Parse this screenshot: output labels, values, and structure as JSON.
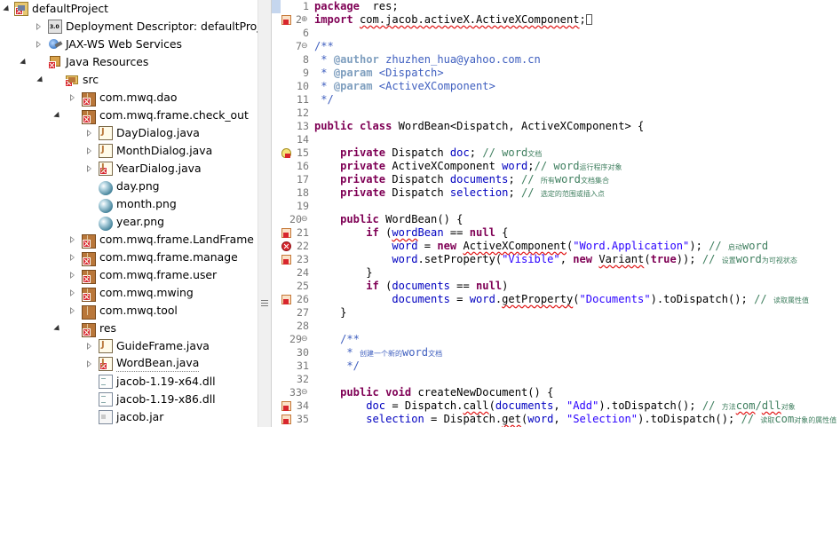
{
  "explorer": {
    "items": [
      {
        "label": "defaultProject",
        "icon": "project-icon",
        "arrow": "expanded",
        "err": true
      },
      {
        "label": "Deployment Descriptor: defaultProject",
        "icon": "deployment-descriptor-icon",
        "arrow": "collapsed",
        "err": false
      },
      {
        "label": "JAX-WS Web Services",
        "icon": "jax-ws-icon",
        "arrow": "collapsed",
        "err": false
      },
      {
        "label": "Java Resources",
        "icon": "java-resources-icon",
        "arrow": "expanded",
        "err": true
      },
      {
        "label": "src",
        "icon": "source-folder-icon",
        "arrow": "expanded",
        "err": true
      },
      {
        "label": "com.mwq.dao",
        "icon": "package-icon",
        "arrow": "collapsed",
        "err": true
      },
      {
        "label": "com.mwq.frame.check_out",
        "icon": "package-icon",
        "arrow": "expanded",
        "err": true
      },
      {
        "label": "DayDialog.java",
        "icon": "java-file-icon",
        "arrow": "collapsed",
        "err": false
      },
      {
        "label": "MonthDialog.java",
        "icon": "java-file-icon",
        "arrow": "collapsed",
        "err": false
      },
      {
        "label": "YearDialog.java",
        "icon": "java-file-icon",
        "arrow": "collapsed",
        "err": true
      },
      {
        "label": "day.png",
        "icon": "png-file-icon",
        "arrow": "none",
        "err": false
      },
      {
        "label": "month.png",
        "icon": "png-file-icon",
        "arrow": "none",
        "err": false
      },
      {
        "label": "year.png",
        "icon": "png-file-icon",
        "arrow": "none",
        "err": false
      },
      {
        "label": "com.mwq.frame.LandFrame",
        "icon": "package-icon",
        "arrow": "collapsed",
        "err": true
      },
      {
        "label": "com.mwq.frame.manage",
        "icon": "package-icon",
        "arrow": "collapsed",
        "err": true
      },
      {
        "label": "com.mwq.frame.user",
        "icon": "package-icon",
        "arrow": "collapsed",
        "err": true
      },
      {
        "label": "com.mwq.mwing",
        "icon": "package-icon",
        "arrow": "collapsed",
        "err": true
      },
      {
        "label": "com.mwq.tool",
        "icon": "package-icon",
        "arrow": "collapsed",
        "err": false
      },
      {
        "label": "res",
        "icon": "package-icon",
        "arrow": "expanded",
        "err": true
      },
      {
        "label": "GuideFrame.java",
        "icon": "java-file-icon",
        "arrow": "collapsed",
        "err": false
      },
      {
        "label": "WordBean.java",
        "icon": "java-file-icon",
        "arrow": "collapsed",
        "err": true,
        "selected": true
      },
      {
        "label": "jacob-1.19-x64.dll",
        "icon": "dll-file-icon",
        "arrow": "none",
        "err": false
      },
      {
        "label": "jacob-1.19-x86.dll",
        "icon": "dll-file-icon",
        "arrow": "none",
        "err": false
      },
      {
        "label": "jacob.jar",
        "icon": "jar-file-icon",
        "arrow": "none",
        "err": false
      }
    ]
  },
  "editor": {
    "lines": [
      {
        "n": "1",
        "gutter": "",
        "fold": "",
        "code": [
          [
            "kw",
            "package"
          ],
          [
            "",
            "  res;"
          ]
        ]
      },
      {
        "n": "2",
        "gutter": "err",
        "fold": "⊕",
        "code": [
          [
            "kw",
            "import"
          ],
          [
            "",
            " "
          ],
          [
            "squig",
            "com.jacob.activeX.ActiveXComponent"
          ],
          [
            "",
            ";"
          ],
          [
            "caret",
            ""
          ]
        ]
      },
      {
        "n": "6",
        "gutter": "",
        "fold": "",
        "code": []
      },
      {
        "n": "7",
        "gutter": "",
        "fold": "⊖",
        "code": [
          [
            "jd",
            "/**"
          ]
        ]
      },
      {
        "n": "8",
        "gutter": "",
        "fold": "",
        "code": [
          [
            "jd",
            " * "
          ],
          [
            "tag",
            "@author"
          ],
          [
            "jd",
            " zhuzhen_hua@yahoo.com.cn"
          ]
        ]
      },
      {
        "n": "9",
        "gutter": "",
        "fold": "",
        "code": [
          [
            "jd",
            " * "
          ],
          [
            "tag",
            "@param"
          ],
          [
            "jd",
            " <Dispatch>"
          ]
        ]
      },
      {
        "n": "10",
        "gutter": "",
        "fold": "",
        "code": [
          [
            "jd",
            " * "
          ],
          [
            "tag",
            "@param"
          ],
          [
            "jd",
            " <ActiveXComponent>"
          ]
        ]
      },
      {
        "n": "11",
        "gutter": "",
        "fold": "",
        "code": [
          [
            "jd",
            " */"
          ]
        ]
      },
      {
        "n": "12",
        "gutter": "",
        "fold": "",
        "code": []
      },
      {
        "n": "13",
        "gutter": "",
        "fold": "",
        "code": [
          [
            "kw",
            "public class"
          ],
          [
            "",
            " WordBean<Dispatch, ActiveXComponent> {"
          ]
        ]
      },
      {
        "n": "14",
        "gutter": "",
        "fold": "",
        "code": []
      },
      {
        "n": "15",
        "gutter": "bulb",
        "fold": "",
        "code": [
          [
            "",
            "    "
          ],
          [
            "kw",
            "private"
          ],
          [
            "",
            " Dispatch "
          ],
          [
            "fld",
            "doc"
          ],
          [
            "",
            "; "
          ],
          [
            "cmt",
            "// word"
          ],
          [
            "cmt cjk",
            "文档"
          ]
        ]
      },
      {
        "n": "16",
        "gutter": "",
        "fold": "",
        "code": [
          [
            "",
            "    "
          ],
          [
            "kw",
            "private"
          ],
          [
            "",
            " ActiveXComponent "
          ],
          [
            "fld",
            "word"
          ],
          [
            "",
            ";"
          ],
          [
            "cmt",
            "// word"
          ],
          [
            "cmt cjk",
            "运行程序对象"
          ]
        ]
      },
      {
        "n": "17",
        "gutter": "",
        "fold": "",
        "code": [
          [
            "",
            "    "
          ],
          [
            "kw",
            "private"
          ],
          [
            "",
            " Dispatch "
          ],
          [
            "fld",
            "documents"
          ],
          [
            "",
            "; "
          ],
          [
            "cmt",
            "// "
          ],
          [
            "cmt cjk",
            "所有"
          ],
          [
            "cmt",
            "word"
          ],
          [
            "cmt cjk",
            "文档集合"
          ]
        ]
      },
      {
        "n": "18",
        "gutter": "",
        "fold": "",
        "code": [
          [
            "",
            "    "
          ],
          [
            "kw",
            "private"
          ],
          [
            "",
            " Dispatch "
          ],
          [
            "fld",
            "selection"
          ],
          [
            "",
            "; "
          ],
          [
            "cmt",
            "// "
          ],
          [
            "cmt cjk",
            "选定的范围或插入点"
          ]
        ]
      },
      {
        "n": "19",
        "gutter": "",
        "fold": "",
        "code": []
      },
      {
        "n": "20",
        "gutter": "",
        "fold": "⊖",
        "code": [
          [
            "",
            "    "
          ],
          [
            "kw",
            "public"
          ],
          [
            "",
            " WordBean() {"
          ]
        ]
      },
      {
        "n": "21",
        "gutter": "err",
        "fold": "",
        "code": [
          [
            "",
            "        "
          ],
          [
            "kw",
            "if"
          ],
          [
            "",
            " ("
          ],
          [
            "fld squig",
            "word"
          ],
          [
            "fld",
            "Bean"
          ],
          [
            "",
            " == "
          ],
          [
            "kw",
            "null"
          ],
          [
            "",
            " {"
          ]
        ]
      },
      {
        "n": "22",
        "gutter": "circle",
        "fold": "",
        "code": [
          [
            "",
            "            "
          ],
          [
            "fld",
            "word"
          ],
          [
            "",
            " = "
          ],
          [
            "kw",
            "new"
          ],
          [
            "",
            " "
          ],
          [
            "squig",
            "ActiveXComponent"
          ],
          [
            "",
            "("
          ],
          [
            "str",
            "\"Word.Application\""
          ],
          [
            "",
            "); "
          ],
          [
            "cmt",
            "// "
          ],
          [
            "cmt cjk",
            "启动"
          ],
          [
            "cmt",
            "word"
          ]
        ]
      },
      {
        "n": "23",
        "gutter": "err",
        "fold": "",
        "code": [
          [
            "",
            "            "
          ],
          [
            "fld",
            "word"
          ],
          [
            "",
            ".setProperty("
          ],
          [
            "str",
            "\"Visible\""
          ],
          [
            "",
            ", "
          ],
          [
            "kw",
            "new"
          ],
          [
            "",
            " "
          ],
          [
            "squig",
            "Variant"
          ],
          [
            "",
            "("
          ],
          [
            "kw",
            "true"
          ],
          [
            "",
            "));"
          ],
          [
            "",
            " "
          ],
          [
            "cmt",
            "// "
          ],
          [
            "cmt cjk",
            "设置"
          ],
          [
            "cmt",
            "word"
          ],
          [
            "cmt cjk",
            "为可视状态"
          ]
        ]
      },
      {
        "n": "24",
        "gutter": "",
        "fold": "",
        "code": [
          [
            "",
            "        }"
          ]
        ]
      },
      {
        "n": "25",
        "gutter": "",
        "fold": "",
        "code": [
          [
            "",
            "        "
          ],
          [
            "kw",
            "if"
          ],
          [
            "",
            " ("
          ],
          [
            "fld",
            "documents"
          ],
          [
            "",
            " == "
          ],
          [
            "kw",
            "null"
          ],
          [
            "",
            ")"
          ]
        ]
      },
      {
        "n": "26",
        "gutter": "err",
        "fold": "",
        "code": [
          [
            "",
            "            "
          ],
          [
            "fld",
            "documents"
          ],
          [
            "",
            " = "
          ],
          [
            "fld",
            "word"
          ],
          [
            "",
            "."
          ],
          [
            "squig",
            "getProperty"
          ],
          [
            "",
            "("
          ],
          [
            "str",
            "\"Documents\""
          ],
          [
            "",
            ").toDispatch(); "
          ],
          [
            "cmt",
            "// "
          ],
          [
            "cmt cjk",
            "读取属性值"
          ]
        ]
      },
      {
        "n": "27",
        "gutter": "",
        "fold": "",
        "code": [
          [
            "",
            "    }"
          ]
        ]
      },
      {
        "n": "28",
        "gutter": "",
        "fold": "",
        "code": []
      },
      {
        "n": "29",
        "gutter": "",
        "fold": "⊖",
        "code": [
          [
            "",
            "    "
          ],
          [
            "jd",
            "/**"
          ]
        ]
      },
      {
        "n": "30",
        "gutter": "",
        "fold": "",
        "code": [
          [
            "",
            "    "
          ],
          [
            "jd",
            " * "
          ],
          [
            "jd cjk",
            "创建一个新的"
          ],
          [
            "jd",
            "word"
          ],
          [
            "jd cjk",
            "文档"
          ]
        ]
      },
      {
        "n": "31",
        "gutter": "",
        "fold": "",
        "code": [
          [
            "",
            "    "
          ],
          [
            "jd",
            " */"
          ]
        ]
      },
      {
        "n": "32",
        "gutter": "",
        "fold": "",
        "code": []
      },
      {
        "n": "33",
        "gutter": "",
        "fold": "⊖",
        "code": [
          [
            "",
            "    "
          ],
          [
            "kw",
            "public void"
          ],
          [
            "",
            " createNewDocument() {"
          ]
        ]
      },
      {
        "n": "34",
        "gutter": "err",
        "fold": "",
        "code": [
          [
            "",
            "        "
          ],
          [
            "fld",
            "doc"
          ],
          [
            "",
            " = Dispatch."
          ],
          [
            "squig",
            "call"
          ],
          [
            "",
            "("
          ],
          [
            "fld",
            "documents"
          ],
          [
            "",
            ", "
          ],
          [
            "str",
            "\"Add\""
          ],
          [
            "",
            ").toDispatch(); "
          ],
          [
            "cmt",
            "// "
          ],
          [
            "cmt cjk",
            "方法"
          ],
          [
            "cmt squig",
            "com"
          ],
          [
            "cmt",
            "/"
          ],
          [
            "cmt squig",
            "dll"
          ],
          [
            "cmt cjk",
            "对象"
          ]
        ]
      },
      {
        "n": "35",
        "gutter": "err",
        "fold": "",
        "code": [
          [
            "",
            "        "
          ],
          [
            "fld",
            "selection"
          ],
          [
            "",
            " = Dispatch."
          ],
          [
            "squig",
            "get"
          ],
          [
            "",
            "("
          ],
          [
            "fld",
            "word"
          ],
          [
            "",
            ", "
          ],
          [
            "str",
            "\"Selection\""
          ],
          [
            "",
            ").toDispatch(); "
          ],
          [
            "cmt",
            "// "
          ],
          [
            "cmt cjk",
            "读取"
          ],
          [
            "cmt",
            "com"
          ],
          [
            "cmt cjk",
            "对象的属性值"
          ]
        ]
      }
    ]
  }
}
